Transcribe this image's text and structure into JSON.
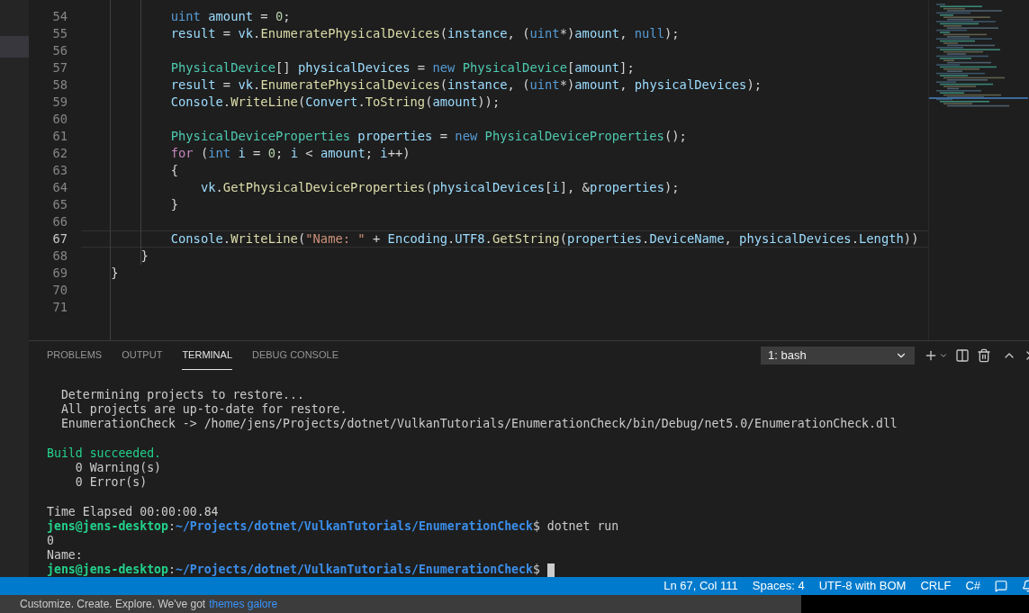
{
  "editor": {
    "lines": [
      {
        "number": "54",
        "current": false,
        "tokens": [
          {
            "kind": "keyword",
            "text": "            uint"
          },
          {
            "kind": "variable",
            "text": " amount"
          },
          {
            "kind": "plain",
            "text": " = "
          },
          {
            "kind": "number",
            "text": "0"
          },
          {
            "kind": "plain",
            "text": ";"
          }
        ]
      },
      {
        "number": "55",
        "current": false,
        "tokens": [
          {
            "kind": "variable",
            "text": "            result"
          },
          {
            "kind": "plain",
            "text": " = "
          },
          {
            "kind": "variable",
            "text": "vk"
          },
          {
            "kind": "plain",
            "text": "."
          },
          {
            "kind": "function",
            "text": "EnumeratePhysicalDevices"
          },
          {
            "kind": "plain",
            "text": "("
          },
          {
            "kind": "variable",
            "text": "instance"
          },
          {
            "kind": "plain",
            "text": ", ("
          },
          {
            "kind": "keyword",
            "text": "uint"
          },
          {
            "kind": "plain",
            "text": "*)"
          },
          {
            "kind": "variable",
            "text": "amount"
          },
          {
            "kind": "plain",
            "text": ", "
          },
          {
            "kind": "keyword",
            "text": "null"
          },
          {
            "kind": "plain",
            "text": ");"
          }
        ]
      },
      {
        "number": "56",
        "current": false
      },
      {
        "number": "57",
        "current": false,
        "tokens": [
          {
            "kind": "type",
            "text": "            PhysicalDevice"
          },
          {
            "kind": "plain",
            "text": "[] "
          },
          {
            "kind": "variable",
            "text": "physicalDevices"
          },
          {
            "kind": "plain",
            "text": " = "
          },
          {
            "kind": "keyword",
            "text": "new"
          },
          {
            "kind": "type",
            "text": " PhysicalDevice"
          },
          {
            "kind": "plain",
            "text": "["
          },
          {
            "kind": "variable",
            "text": "amount"
          },
          {
            "kind": "plain",
            "text": "];"
          }
        ]
      },
      {
        "number": "58",
        "current": false,
        "tokens": [
          {
            "kind": "variable",
            "text": "            result"
          },
          {
            "kind": "plain",
            "text": " = "
          },
          {
            "kind": "variable",
            "text": "vk"
          },
          {
            "kind": "plain",
            "text": "."
          },
          {
            "kind": "function",
            "text": "EnumeratePhysicalDevices"
          },
          {
            "kind": "plain",
            "text": "("
          },
          {
            "kind": "variable",
            "text": "instance"
          },
          {
            "kind": "plain",
            "text": ", ("
          },
          {
            "kind": "keyword",
            "text": "uint"
          },
          {
            "kind": "plain",
            "text": "*)"
          },
          {
            "kind": "variable",
            "text": "amount"
          },
          {
            "kind": "plain",
            "text": ", "
          },
          {
            "kind": "variable",
            "text": "physicalDevices"
          },
          {
            "kind": "plain",
            "text": ");"
          }
        ]
      },
      {
        "number": "59",
        "current": false,
        "tokens": [
          {
            "kind": "variable",
            "text": "            Console"
          },
          {
            "kind": "plain",
            "text": "."
          },
          {
            "kind": "function",
            "text": "WriteLine"
          },
          {
            "kind": "plain",
            "text": "("
          },
          {
            "kind": "variable",
            "text": "Convert"
          },
          {
            "kind": "plain",
            "text": "."
          },
          {
            "kind": "function",
            "text": "ToString"
          },
          {
            "kind": "plain",
            "text": "("
          },
          {
            "kind": "variable",
            "text": "amount"
          },
          {
            "kind": "plain",
            "text": "));"
          }
        ]
      },
      {
        "number": "60",
        "current": false
      },
      {
        "number": "61",
        "current": false,
        "tokens": [
          {
            "kind": "type",
            "text": "            PhysicalDeviceProperties"
          },
          {
            "kind": "variable",
            "text": " properties"
          },
          {
            "kind": "plain",
            "text": " = "
          },
          {
            "kind": "keyword",
            "text": "new"
          },
          {
            "kind": "type",
            "text": " PhysicalDeviceProperties"
          },
          {
            "kind": "plain",
            "text": "();"
          }
        ]
      },
      {
        "number": "62",
        "current": false,
        "tokens": [
          {
            "kind": "control",
            "text": "            for"
          },
          {
            "kind": "plain",
            "text": " ("
          },
          {
            "kind": "keyword",
            "text": "int"
          },
          {
            "kind": "variable",
            "text": " i"
          },
          {
            "kind": "plain",
            "text": " = "
          },
          {
            "kind": "number",
            "text": "0"
          },
          {
            "kind": "plain",
            "text": "; "
          },
          {
            "kind": "variable",
            "text": "i"
          },
          {
            "kind": "plain",
            "text": " < "
          },
          {
            "kind": "variable",
            "text": "amount"
          },
          {
            "kind": "plain",
            "text": "; "
          },
          {
            "kind": "variable",
            "text": "i"
          },
          {
            "kind": "plain",
            "text": "++)"
          }
        ]
      },
      {
        "number": "63",
        "current": false,
        "tokens": [
          {
            "kind": "plain",
            "text": "            {"
          }
        ]
      },
      {
        "number": "64",
        "current": false,
        "tokens": [
          {
            "kind": "variable",
            "text": "                vk"
          },
          {
            "kind": "plain",
            "text": "."
          },
          {
            "kind": "function",
            "text": "GetPhysicalDeviceProperties"
          },
          {
            "kind": "plain",
            "text": "("
          },
          {
            "kind": "variable",
            "text": "physicalDevices"
          },
          {
            "kind": "plain",
            "text": "["
          },
          {
            "kind": "variable",
            "text": "i"
          },
          {
            "kind": "plain",
            "text": "], &"
          },
          {
            "kind": "variable",
            "text": "properties"
          },
          {
            "kind": "plain",
            "text": ");"
          }
        ]
      },
      {
        "number": "65",
        "current": false,
        "tokens": [
          {
            "kind": "plain",
            "text": "            }"
          }
        ]
      },
      {
        "number": "66",
        "current": false
      },
      {
        "number": "67",
        "current": true,
        "tokens": [
          {
            "kind": "variable",
            "text": "            Console"
          },
          {
            "kind": "plain",
            "text": "."
          },
          {
            "kind": "function",
            "text": "WriteLine"
          },
          {
            "kind": "plain",
            "text": "("
          },
          {
            "kind": "string",
            "text": "\"Name: \""
          },
          {
            "kind": "plain",
            "text": " + "
          },
          {
            "kind": "variable",
            "text": "Encoding"
          },
          {
            "kind": "plain",
            "text": "."
          },
          {
            "kind": "variable",
            "text": "UTF8"
          },
          {
            "kind": "plain",
            "text": "."
          },
          {
            "kind": "function",
            "text": "GetString"
          },
          {
            "kind": "plain",
            "text": "("
          },
          {
            "kind": "variable",
            "text": "properties"
          },
          {
            "kind": "plain",
            "text": "."
          },
          {
            "kind": "variable",
            "text": "DeviceName"
          },
          {
            "kind": "plain",
            "text": ", "
          },
          {
            "kind": "variable",
            "text": "physicalDevices"
          },
          {
            "kind": "plain",
            "text": "."
          },
          {
            "kind": "variable",
            "text": "Length"
          },
          {
            "kind": "plain",
            "text": "))"
          }
        ]
      },
      {
        "number": "68",
        "current": false,
        "tokens": [
          {
            "kind": "plain",
            "text": "        }"
          }
        ]
      },
      {
        "number": "69",
        "current": false,
        "tokens": [
          {
            "kind": "plain",
            "text": "    }"
          }
        ]
      },
      {
        "number": "70",
        "current": false
      },
      {
        "number": "71",
        "current": false
      }
    ]
  },
  "panel": {
    "tabs": [
      {
        "label": "PROBLEMS",
        "selected": false
      },
      {
        "label": "OUTPUT",
        "selected": false
      },
      {
        "label": "TERMINAL",
        "selected": true
      },
      {
        "label": "DEBUG CONSOLE",
        "selected": false
      }
    ],
    "terminal_select": "1: bash",
    "terminal_lines": [
      {
        "gap_before": false,
        "segments": [
          {
            "kind": "plain",
            "text": "  Determining projects to restore..."
          }
        ]
      },
      {
        "gap_before": false,
        "segments": [
          {
            "kind": "plain",
            "text": "  All projects are up-to-date for restore."
          }
        ]
      },
      {
        "gap_before": false,
        "segments": [
          {
            "kind": "plain",
            "text": "  EnumerationCheck -> /home/jens/Projects/dotnet/VulkanTutorials/EnumerationCheck/bin/Debug/net5.0/EnumerationCheck.dll"
          }
        ]
      },
      {
        "gap_before": true,
        "segments": [
          {
            "kind": "success",
            "text": "Build succeeded."
          }
        ]
      },
      {
        "gap_before": false,
        "segments": [
          {
            "kind": "plain",
            "text": "    0 Warning(s)"
          }
        ]
      },
      {
        "gap_before": false,
        "segments": [
          {
            "kind": "plain",
            "text": "    0 Error(s)"
          }
        ]
      },
      {
        "gap_before": true,
        "segments": [
          {
            "kind": "plain",
            "text": "Time Elapsed 00:00:00.84"
          }
        ]
      },
      {
        "gap_before": false,
        "segments": [
          {
            "kind": "user",
            "text": "jens@jens-desktop"
          },
          {
            "kind": "plain",
            "text": ":"
          },
          {
            "kind": "path",
            "text": "~/Projects/dotnet/VulkanTutorials/EnumerationCheck"
          },
          {
            "kind": "plain",
            "text": "$ dotnet run"
          }
        ]
      },
      {
        "gap_before": false,
        "segments": [
          {
            "kind": "plain",
            "text": "0"
          }
        ]
      },
      {
        "gap_before": false,
        "segments": [
          {
            "kind": "plain",
            "text": "Name:"
          }
        ]
      },
      {
        "gap_before": false,
        "cursor": true,
        "segments": [
          {
            "kind": "user",
            "text": "jens@jens-desktop"
          },
          {
            "kind": "plain",
            "text": ":"
          },
          {
            "kind": "path",
            "text": "~/Projects/dotnet/VulkanTutorials/EnumerationCheck"
          },
          {
            "kind": "plain",
            "text": "$"
          }
        ]
      }
    ]
  },
  "status_bar": {
    "items": [
      "Ln 67, Col 111",
      "Spaces: 4",
      "UTF-8 with BOM",
      "CRLF",
      "C#"
    ]
  },
  "notification": {
    "text": "Customize. Create. Explore. We've got",
    "link": "themes galore"
  }
}
